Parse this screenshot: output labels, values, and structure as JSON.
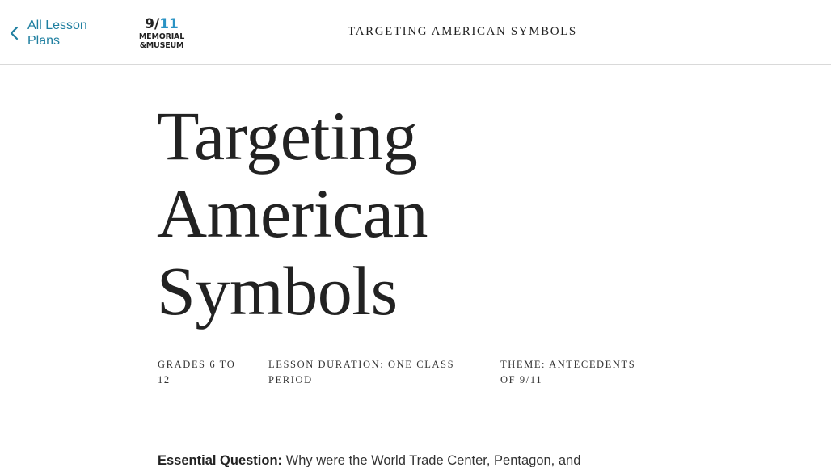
{
  "header": {
    "back_label": "All Lesson Plans",
    "logo": {
      "mark_nine": "9/",
      "mark_elevens": "11",
      "line1": "MEMORIAL",
      "line2": "&MUSEUM"
    },
    "title": "TARGETING AMERICAN SYMBOLS"
  },
  "main": {
    "title": "Targeting American Symbols",
    "meta": {
      "grades": "GRADES 6 TO 12",
      "duration": "LESSON DURATION: ONE CLASS PERIOD",
      "theme": "THEME: ANTECEDENTS OF 9/11"
    },
    "essential_question": {
      "label": "Essential Question:",
      "text": "Why were the World Trade Center, Pentagon, and"
    }
  },
  "colors": {
    "link": "#1f7fa0",
    "logo_accent": "#2a93c4",
    "text": "#222222"
  },
  "icons": {
    "back": "chevron-left-icon"
  }
}
